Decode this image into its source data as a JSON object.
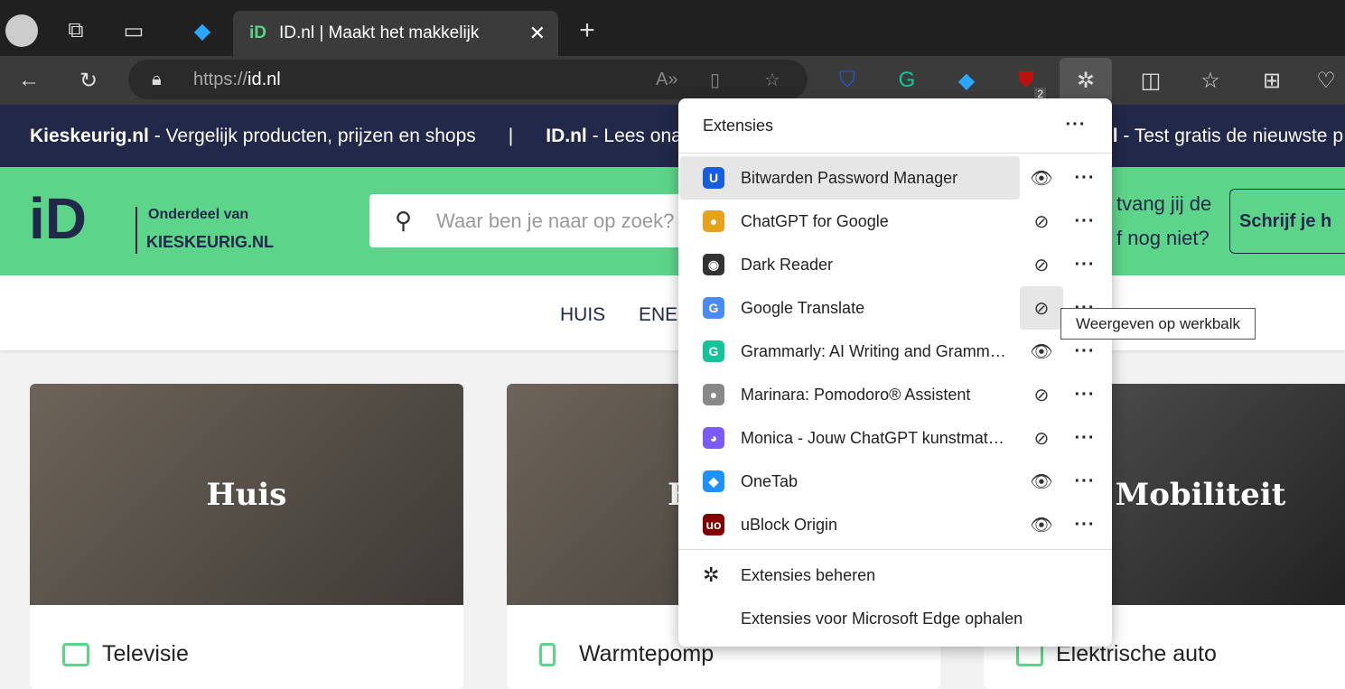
{
  "browser": {
    "tab_title": "ID.nl | Maakt het makkelijk",
    "url_prefix": "https://",
    "url_host": "id.nl",
    "ublock_badge": "2"
  },
  "banner": {
    "items": [
      {
        "bold": "Kieskeurig.nl",
        "text": " - Vergelijk producten, prijzen en shops"
      },
      {
        "bold": "ID.nl",
        "text": " - Lees onafhankelijke"
      },
      {
        "bold": "w.nl",
        "text": " - Test gratis de nieuwste p"
      }
    ]
  },
  "site": {
    "logo": "iD.NL",
    "tagline1": "Onderdeel van",
    "tagline2": "KIESKEURIG.NL",
    "search_placeholder": "Waar ben je naar op zoek?",
    "newsletter1": "tvang jij de",
    "newsletter2": "f nog niet?",
    "subscribe": "Schrijf je h",
    "nav": [
      "HUIS",
      "ENE"
    ]
  },
  "cards": [
    {
      "title": "Huis",
      "item": "Televisie"
    },
    {
      "title": "E",
      "item": "Warmtepomp"
    },
    {
      "title": "Mobiliteit",
      "item": "Elektrische auto"
    }
  ],
  "extensions": {
    "title": "Extensies",
    "items": [
      {
        "name": "Bitwarden Password Manager",
        "visible": true,
        "color": "#175ddc",
        "glyph": "U"
      },
      {
        "name": "ChatGPT for Google",
        "visible": false,
        "color": "#e6a21a",
        "glyph": "●"
      },
      {
        "name": "Dark Reader",
        "visible": false,
        "color": "#333",
        "glyph": "◉"
      },
      {
        "name": "Google Translate",
        "visible": false,
        "color": "#4a8af4",
        "glyph": "G"
      },
      {
        "name": "Grammarly: AI Writing and Grammar Checker",
        "visible": true,
        "color": "#15c39a",
        "glyph": "G"
      },
      {
        "name": "Marinara: Pomodoro® Assistent",
        "visible": false,
        "color": "#888",
        "glyph": "●"
      },
      {
        "name": "Monica - Jouw ChatGPT kunstmatige intelligentie",
        "visible": false,
        "color": "#7a5af8",
        "glyph": "◕"
      },
      {
        "name": "OneTab",
        "visible": true,
        "color": "#1e90ff",
        "glyph": "◆"
      },
      {
        "name": "uBlock Origin",
        "visible": true,
        "color": "#800000",
        "glyph": "uo"
      }
    ],
    "manage": "Extensies beheren",
    "get": "Extensies voor Microsoft Edge ophalen",
    "tooltip": "Weergeven op werkbalk"
  }
}
